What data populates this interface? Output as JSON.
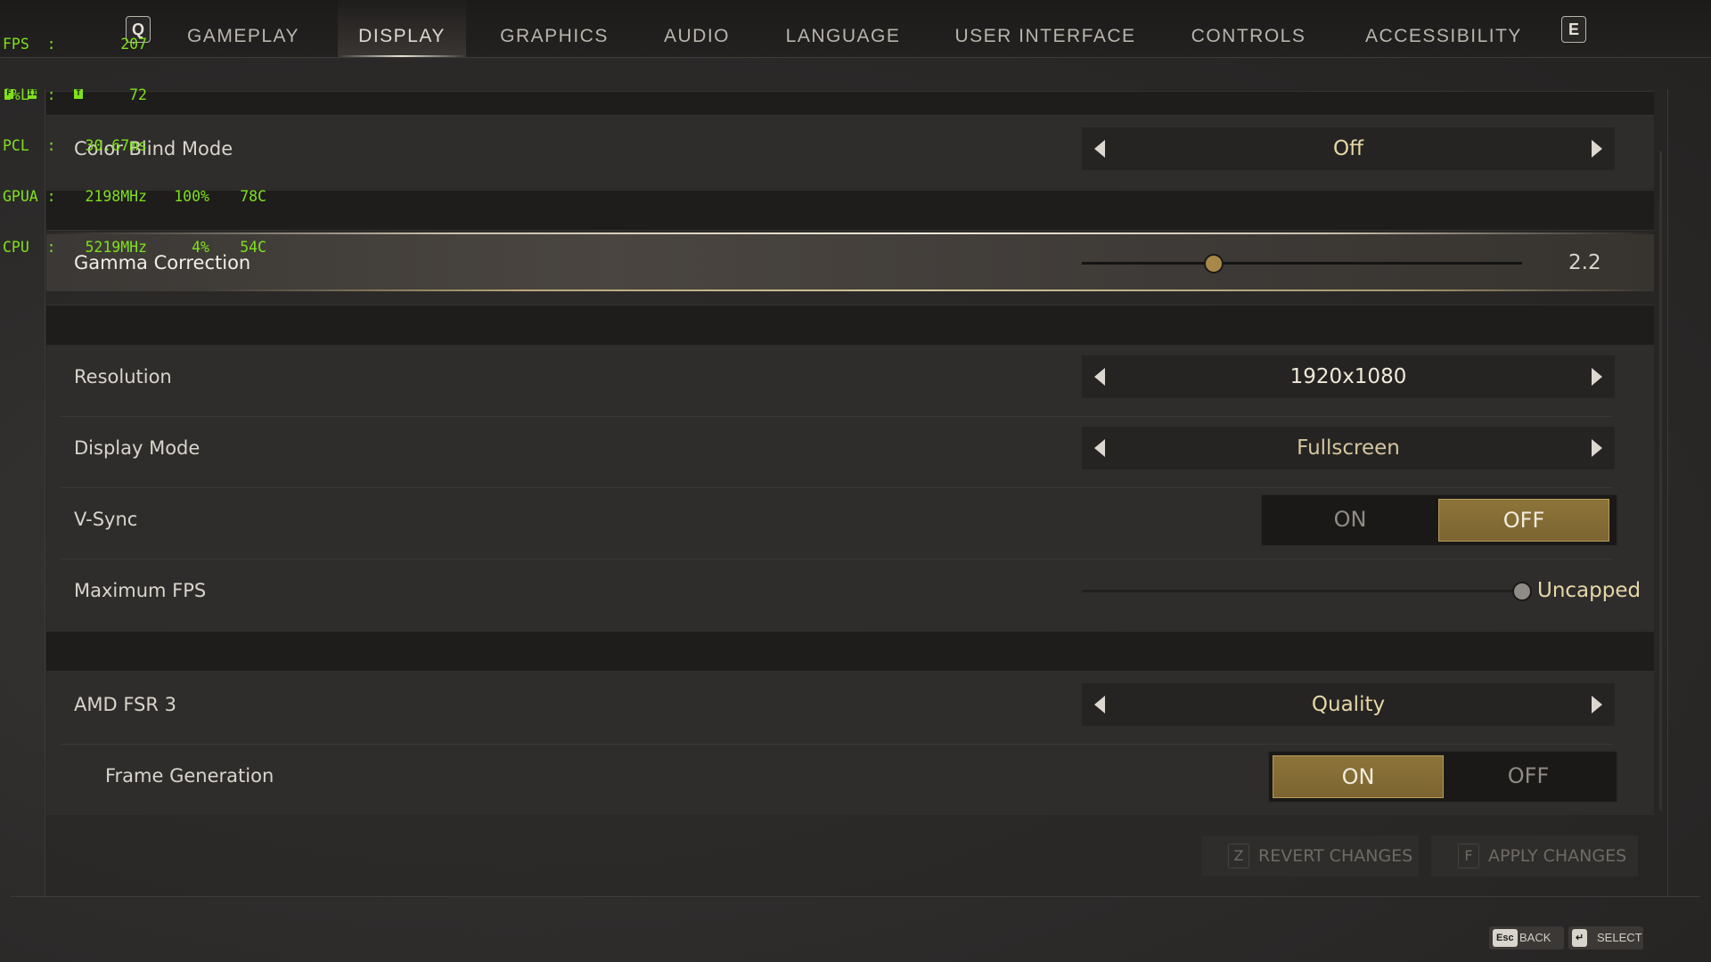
{
  "perf_overlay": {
    "rows": [
      {
        "label": "FPS  :",
        "v1": "207",
        "v2": "",
        "v3": ""
      },
      {
        "label": "1%L  :",
        "v1": "72",
        "v2": "",
        "v3": ""
      },
      {
        "label": "PCL  :",
        "v1": "30.67ms",
        "v2": "",
        "v3": ""
      },
      {
        "label": "GPUA :",
        "v1": "2198MHz",
        "v2": "100%",
        "v3": "78C"
      },
      {
        "label": "CPU  :",
        "v1": "5219MHz",
        "v2": "4%",
        "v3": "54C"
      }
    ],
    "icons": [
      "F",
      "II",
      "T"
    ]
  },
  "nav": {
    "prev_key": "Q",
    "next_key": "E",
    "tabs": [
      {
        "label": "GAMEPLAY",
        "active": false
      },
      {
        "label": "DISPLAY",
        "active": true
      },
      {
        "label": "GRAPHICS",
        "active": false
      },
      {
        "label": "AUDIO",
        "active": false
      },
      {
        "label": "LANGUAGE",
        "active": false
      },
      {
        "label": "USER INTERFACE",
        "active": false
      },
      {
        "label": "CONTROLS",
        "active": false
      },
      {
        "label": "ACCESSIBILITY",
        "active": false
      }
    ]
  },
  "settings": {
    "color_blind_mode": {
      "label": "Color Blind Mode",
      "value": "Off"
    },
    "gamma_correction": {
      "label": "Gamma Correction",
      "value": "2.2",
      "fraction": 0.3
    },
    "resolution": {
      "label": "Resolution",
      "value": "1920x1080"
    },
    "display_mode": {
      "label": "Display Mode",
      "value": "Fullscreen"
    },
    "vsync": {
      "label": "V-Sync",
      "on_label": "ON",
      "off_label": "OFF",
      "selected": "OFF"
    },
    "maximum_fps": {
      "label": "Maximum FPS",
      "value": "Uncapped",
      "fraction": 1.0
    },
    "amd_fsr3": {
      "label": "AMD FSR 3",
      "value": "Quality"
    },
    "frame_generation": {
      "label": "Frame Generation",
      "on_label": "ON",
      "off_label": "OFF",
      "selected": "ON"
    }
  },
  "footer": {
    "revert": {
      "key": "Z",
      "label": "REVERT CHANGES"
    },
    "apply": {
      "key": "F",
      "label": "APPLY CHANGES"
    }
  },
  "hints": {
    "back": {
      "key": "Esc",
      "label": "BACK"
    },
    "select": {
      "key": "↵",
      "label": "SELECT"
    }
  },
  "colors": {
    "accent_gold": "#8c7439",
    "value_gold": "#e6d7a6",
    "text_light": "#d9d5cc",
    "perf_green": "#7fe01c"
  }
}
